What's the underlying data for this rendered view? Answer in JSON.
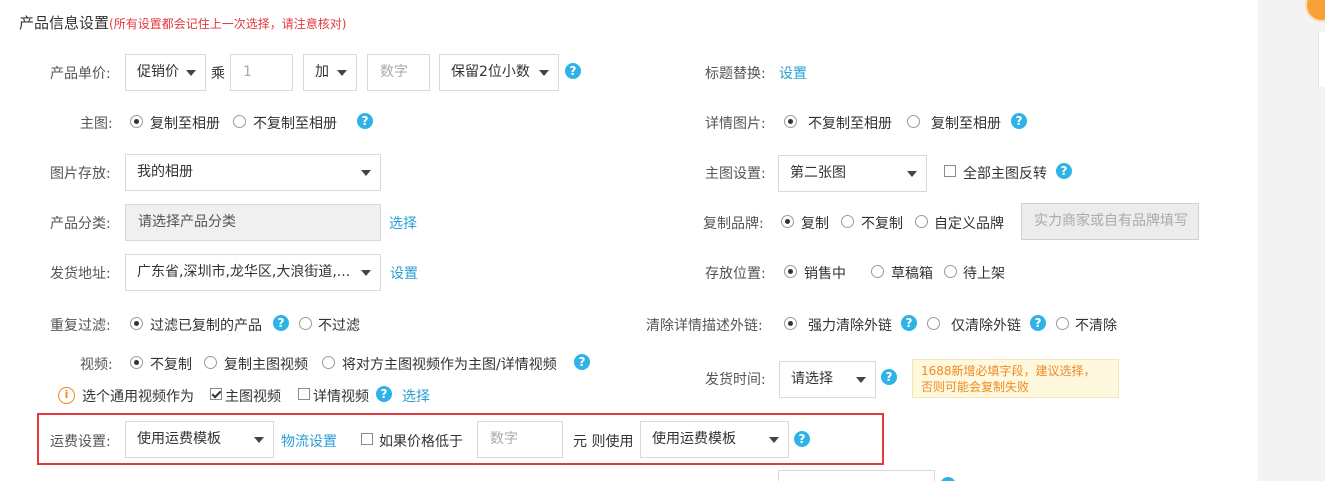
{
  "header": {
    "title": "产品信息设置",
    "note": "(所有设置都会记住上一次选择，请注意核对)"
  },
  "price": {
    "label": "产品单价:",
    "base": "促销价",
    "multiply": "乘",
    "factor_placeholder": "1",
    "op": "加",
    "addend_placeholder": "数字",
    "rounding": "保留2位小数"
  },
  "title_replace": {
    "label": "标题替换:",
    "link": "设置"
  },
  "main_image": {
    "label": "主图:",
    "opt1": "复制至相册",
    "opt2": "不复制至相册"
  },
  "detail_image": {
    "label": "详情图片:",
    "opt1": "不复制至相册",
    "opt2": "复制至相册"
  },
  "image_storage": {
    "label": "图片存放:",
    "value": "我的相册"
  },
  "main_image_setting": {
    "label": "主图设置:",
    "value": "第二张图",
    "reverse_label": "全部主图反转"
  },
  "category": {
    "label": "产品分类:",
    "placeholder": "请选择产品分类",
    "link": "选择"
  },
  "brand": {
    "label": "复制品牌:",
    "opt1": "复制",
    "opt2": "不复制",
    "opt3": "自定义品牌",
    "placeholder": "实力商家或自有品牌填写"
  },
  "ship_address": {
    "label": "发货地址:",
    "value": "广东省,深圳市,龙华区,大浪街道,...",
    "link": "设置"
  },
  "storage_location": {
    "label": "存放位置:",
    "opt1": "销售中",
    "opt2": "草稿箱",
    "opt3": "待上架"
  },
  "dedupe": {
    "label": "重复过滤:",
    "opt1": "过滤已复制的产品",
    "opt2": "不过滤"
  },
  "clear_links": {
    "label": "清除详情描述外链:",
    "opt1": "强力清除外链",
    "opt2": "仅清除外链",
    "opt3": "不清除"
  },
  "video": {
    "label": "视频:",
    "opt1": "不复制",
    "opt2": "复制主图视频",
    "opt3": "将对方主图视频作为主图/详情视频",
    "general_label": "选个通用视频作为",
    "general_opt1": "主图视频",
    "general_opt2": "详情视频",
    "general_link": "选择"
  },
  "ship_time": {
    "label": "发货时间:",
    "value": "请选择",
    "tip_line1": "1688新增必填字段，建议选择，",
    "tip_line2": "否则可能会复制失败"
  },
  "freight": {
    "label": "运费设置:",
    "template": "使用运费模板",
    "link": "物流设置",
    "condition_label": "如果价格低于",
    "threshold_placeholder": "数字",
    "unit_then": "元 则使用",
    "alt_template": "使用运费模板"
  },
  "help_glyph": "?",
  "warn_glyph": "i"
}
